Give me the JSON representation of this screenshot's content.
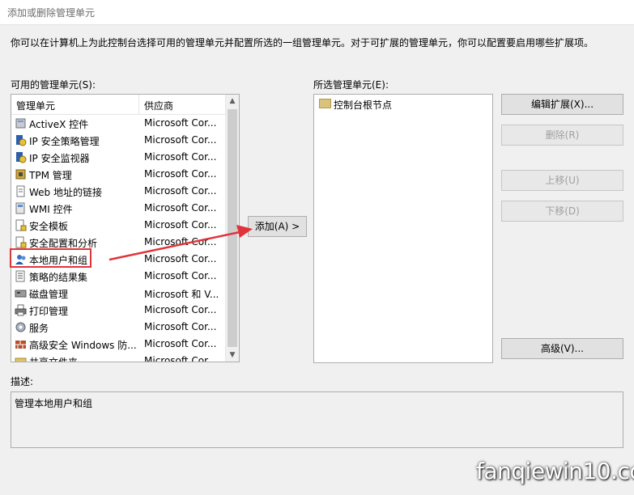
{
  "window": {
    "title": "添加或删除管理单元"
  },
  "intro": "你可以在计算机上为此控制台选择可用的管理单元并配置所选的一组管理单元。对于可扩展的管理单元，你可以配置要启用哪些扩展项。",
  "available": {
    "label": "可用的管理单元(S):",
    "headers": {
      "name": "管理单元",
      "vendor": "供应商"
    },
    "items": [
      {
        "name": "ActiveX 控件",
        "vendor": "Microsoft Cor...",
        "icon": "activex-icon"
      },
      {
        "name": "IP 安全策略管理",
        "vendor": "Microsoft Cor...",
        "icon": "ip-policy-icon"
      },
      {
        "name": "IP 安全监视器",
        "vendor": "Microsoft Cor...",
        "icon": "ip-monitor-icon"
      },
      {
        "name": "TPM 管理",
        "vendor": "Microsoft Cor...",
        "icon": "tpm-icon"
      },
      {
        "name": "Web 地址的链接",
        "vendor": "Microsoft Cor...",
        "icon": "web-link-icon"
      },
      {
        "name": "WMI 控件",
        "vendor": "Microsoft Cor...",
        "icon": "wmi-icon"
      },
      {
        "name": "安全模板",
        "vendor": "Microsoft Cor...",
        "icon": "security-template-icon"
      },
      {
        "name": "安全配置和分析",
        "vendor": "Microsoft Cor...",
        "icon": "security-config-icon"
      },
      {
        "name": "本地用户和组",
        "vendor": "Microsoft Cor...",
        "icon": "users-icon"
      },
      {
        "name": "策略的结果集",
        "vendor": "Microsoft Cor...",
        "icon": "rsop-icon"
      },
      {
        "name": "磁盘管理",
        "vendor": "Microsoft 和 V...",
        "icon": "disk-icon"
      },
      {
        "name": "打印管理",
        "vendor": "Microsoft Cor...",
        "icon": "printer-icon"
      },
      {
        "name": "服务",
        "vendor": "Microsoft Cor...",
        "icon": "gear-icon"
      },
      {
        "name": "高级安全 Windows 防...",
        "vendor": "Microsoft Cor...",
        "icon": "firewall-icon"
      },
      {
        "name": "共享文件夹",
        "vendor": "Microsoft Cor...",
        "icon": "shared-folder-icon"
      }
    ]
  },
  "add_button": "添加(A) >",
  "selected": {
    "label": "所选管理单元(E):",
    "items": [
      {
        "name": "控制台根节点",
        "icon": "folder-icon"
      }
    ]
  },
  "buttons": {
    "edit_extensions": "编辑扩展(X)...",
    "remove": "删除(R)",
    "move_up": "上移(U)",
    "move_down": "下移(D)",
    "advanced": "高级(V)..."
  },
  "description": {
    "label": "描述:",
    "text": "管理本地用户和组"
  },
  "watermark": "fanqiewin10.com",
  "colors": {
    "highlight": "#e0343c",
    "accent_blue": "#1e5fb4"
  }
}
